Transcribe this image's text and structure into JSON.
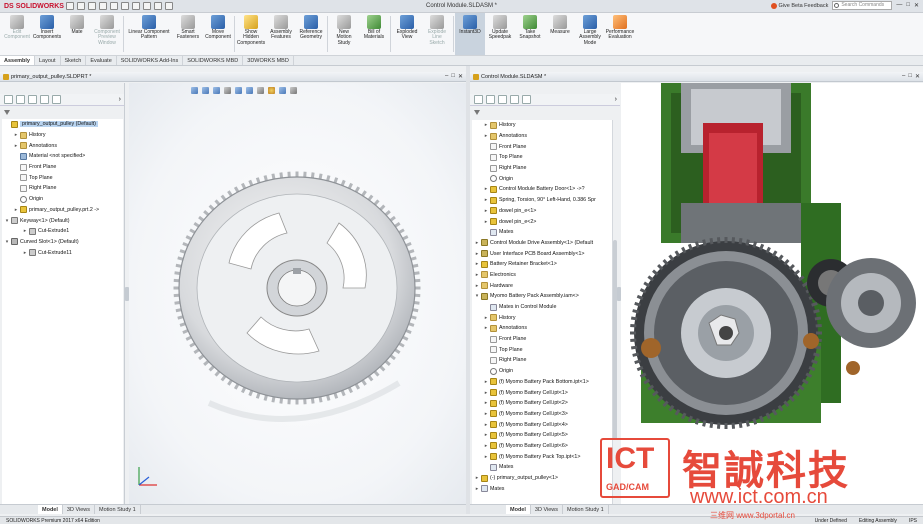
{
  "app": {
    "logo_ds": "DS",
    "logo_sw": "SOLIDWORKS",
    "doc_title": "Control Module.SLDASM *",
    "beta": "Give Beta Feedback",
    "search_placeholder": "Search Commands",
    "win_min": "—",
    "win_max": "□",
    "win_close": "✕"
  },
  "ribbon": [
    {
      "label": "Edit\nComponent",
      "state": "disabled",
      "icon": "edit-component-icon",
      "color": "gray"
    },
    {
      "label": "Insert\nComponents",
      "state": "normal",
      "icon": "insert-components-icon",
      "color": "blue"
    },
    {
      "label": "Mate",
      "state": "normal",
      "icon": "mate-icon",
      "color": "gray"
    },
    {
      "label": "Component\nPreview\nWindow",
      "state": "disabled",
      "icon": "preview-window-icon",
      "color": "gray"
    },
    {
      "label": "Linear Component\nPattern",
      "state": "normal",
      "icon": "linear-pattern-icon",
      "color": "blue",
      "wide": true
    },
    {
      "label": "Smart\nFasteners",
      "state": "normal",
      "icon": "smart-fasteners-icon",
      "color": "gray"
    },
    {
      "label": "Move\nComponent",
      "state": "normal",
      "icon": "move-component-icon",
      "color": "blue"
    },
    {
      "label": "Show\nHidden\nComponents",
      "state": "normal",
      "icon": "show-hidden-icon",
      "color": "yellow"
    },
    {
      "label": "Assembly\nFeatures",
      "state": "normal",
      "icon": "assembly-features-icon",
      "color": "gray"
    },
    {
      "label": "Reference\nGeometry",
      "state": "normal",
      "icon": "reference-geometry-icon",
      "color": "blue"
    },
    {
      "label": "New\nMotion\nStudy",
      "state": "normal",
      "icon": "motion-study-icon",
      "color": "gray"
    },
    {
      "label": "Bill of\nMaterials",
      "state": "normal",
      "icon": "bom-icon",
      "color": "green"
    },
    {
      "label": "Exploded\nView",
      "state": "normal",
      "icon": "exploded-view-icon",
      "color": "blue"
    },
    {
      "label": "Explode\nLine\nSketch",
      "state": "disabled",
      "icon": "explode-line-icon",
      "color": "gray"
    },
    {
      "label": "Instant3D",
      "state": "active",
      "icon": "instant3d-icon",
      "color": "blue"
    },
    {
      "label": "Update\nSpeedpak",
      "state": "normal",
      "icon": "speedpak-icon",
      "color": "gray"
    },
    {
      "label": "Take\nSnapshot",
      "state": "normal",
      "icon": "snapshot-icon",
      "color": "green"
    },
    {
      "label": "Measure",
      "state": "normal",
      "icon": "measure-icon",
      "color": "gray"
    },
    {
      "label": "Large\nAssembly\nMode",
      "state": "normal",
      "icon": "large-assembly-icon",
      "color": "blue"
    },
    {
      "label": "Performance\nEvaluation",
      "state": "normal",
      "icon": "performance-icon",
      "color": "orange"
    }
  ],
  "tabs": [
    {
      "label": "Assembly",
      "active": true
    },
    {
      "label": "Layout"
    },
    {
      "label": "Sketch"
    },
    {
      "label": "Evaluate"
    },
    {
      "label": "SOLIDWORKS Add-Ins"
    },
    {
      "label": "SOLIDWORKS MBD"
    },
    {
      "label": "3DWORKS MBD"
    }
  ],
  "left": {
    "title": "primary_output_pulley.SLDPRT *",
    "tree": [
      {
        "i": 0,
        "ex": "",
        "icon": "part",
        "label": "primary_output_pulley  (Default)",
        "sel": true
      },
      {
        "i": 1,
        "ex": "▸",
        "icon": "folder",
        "label": "History"
      },
      {
        "i": 1,
        "ex": "▸",
        "icon": "folder",
        "label": "Annotations"
      },
      {
        "i": 1,
        "ex": "",
        "icon": "mat",
        "label": "Material <not specified>"
      },
      {
        "i": 1,
        "ex": "",
        "icon": "plane",
        "label": "Front Plane"
      },
      {
        "i": 1,
        "ex": "",
        "icon": "plane",
        "label": "Top Plane"
      },
      {
        "i": 1,
        "ex": "",
        "icon": "plane",
        "label": "Right Plane"
      },
      {
        "i": 1,
        "ex": "",
        "icon": "origin",
        "label": "Origin"
      },
      {
        "i": 1,
        "ex": "▸",
        "icon": "part",
        "label": "primary_output_pulley.prt.2 ->"
      },
      {
        "i": 0,
        "ex": "▾",
        "icon": "feat",
        "label": "Keyway<1> (Default)"
      },
      {
        "i": 2,
        "ex": "▸",
        "icon": "feat",
        "label": "Cut-Extrude1"
      },
      {
        "i": 0,
        "ex": "▾",
        "icon": "slot",
        "label": "Curved Slot<1> (Default)"
      },
      {
        "i": 2,
        "ex": "▸",
        "icon": "feat",
        "label": "Cut-Extrude11"
      }
    ],
    "tabs": [
      {
        "label": "Model",
        "active": true
      },
      {
        "label": "3D Views"
      },
      {
        "label": "Motion Study 1"
      }
    ]
  },
  "right": {
    "title": "Control Module.SLDASM *",
    "tree": [
      {
        "i": 1,
        "ex": "▸",
        "icon": "folder",
        "label": "History"
      },
      {
        "i": 1,
        "ex": "▸",
        "icon": "folder",
        "label": "Annotations"
      },
      {
        "i": 1,
        "ex": "",
        "icon": "plane",
        "label": "Front Plane"
      },
      {
        "i": 1,
        "ex": "",
        "icon": "plane",
        "label": "Top Plane"
      },
      {
        "i": 1,
        "ex": "",
        "icon": "plane",
        "label": "Right Plane"
      },
      {
        "i": 1,
        "ex": "",
        "icon": "origin",
        "label": "Origin"
      },
      {
        "i": 1,
        "ex": "▸",
        "icon": "part",
        "label": "Control Module Battery Door<1> ->?"
      },
      {
        "i": 1,
        "ex": "▸",
        "icon": "part",
        "label": "Spring, Torsion, 90° Left-Hand, 0.386 Spr"
      },
      {
        "i": 1,
        "ex": "▸",
        "icon": "part",
        "label": "dowel pin_e<1>"
      },
      {
        "i": 1,
        "ex": "▸",
        "icon": "part",
        "label": "dowel pin_e<2>"
      },
      {
        "i": 1,
        "ex": "",
        "icon": "mates",
        "label": "Mates"
      },
      {
        "i": 0,
        "ex": "▸",
        "icon": "asm",
        "label": "Control Module Drive Assembly<1> (Default"
      },
      {
        "i": 0,
        "ex": "▸",
        "icon": "asm",
        "label": "User Interface PCB Board Assembly<1>"
      },
      {
        "i": 0,
        "ex": "▸",
        "icon": "part",
        "label": "Battery Retainer Bracket<1>"
      },
      {
        "i": 0,
        "ex": "▸",
        "icon": "folder",
        "label": "Electronics"
      },
      {
        "i": 0,
        "ex": "▸",
        "icon": "folder",
        "label": "Hardware"
      },
      {
        "i": 0,
        "ex": "▾",
        "icon": "asm",
        "label": "Myomo Battery Pack Assembly.iam<>"
      },
      {
        "i": 1,
        "ex": "",
        "icon": "mates",
        "label": "Mates in Control Module"
      },
      {
        "i": 1,
        "ex": "▸",
        "icon": "folder",
        "label": "History"
      },
      {
        "i": 1,
        "ex": "▸",
        "icon": "folder",
        "label": "Annotations"
      },
      {
        "i": 1,
        "ex": "",
        "icon": "plane",
        "label": "Front Plane"
      },
      {
        "i": 1,
        "ex": "",
        "icon": "plane",
        "label": "Top Plane"
      },
      {
        "i": 1,
        "ex": "",
        "icon": "plane",
        "label": "Right Plane"
      },
      {
        "i": 1,
        "ex": "",
        "icon": "origin",
        "label": "Origin"
      },
      {
        "i": 1,
        "ex": "▸",
        "icon": "part",
        "label": "(f) Myomo Battery Pack Bottom.ipt<1>"
      },
      {
        "i": 1,
        "ex": "▸",
        "icon": "part",
        "label": "(f) Myomo Battery Cell.ipt<1>"
      },
      {
        "i": 1,
        "ex": "▸",
        "icon": "part",
        "label": "(f) Myomo Battery Cell.ipt<2>"
      },
      {
        "i": 1,
        "ex": "▸",
        "icon": "part",
        "label": "(f) Myomo Battery Cell.ipt<3>"
      },
      {
        "i": 1,
        "ex": "▸",
        "icon": "part",
        "label": "(f) Myomo Battery Cell.ipt<4>"
      },
      {
        "i": 1,
        "ex": "▸",
        "icon": "part",
        "label": "(f) Myomo Battery Cell.ipt<5>"
      },
      {
        "i": 1,
        "ex": "▸",
        "icon": "part",
        "label": "(f) Myomo Battery Cell.ipt<6>"
      },
      {
        "i": 1,
        "ex": "▸",
        "icon": "part",
        "label": "(f) Myomo Battery Pack Top.ipt<1>"
      },
      {
        "i": 1,
        "ex": "",
        "icon": "mates",
        "label": "Mates"
      },
      {
        "i": 0,
        "ex": "▸",
        "icon": "part",
        "label": "(-) primary_output_pulley<1>"
      },
      {
        "i": 0,
        "ex": "▸",
        "icon": "mates",
        "label": "Mates"
      }
    ],
    "tabs": [
      {
        "label": "Model",
        "active": true
      },
      {
        "label": "3D Views"
      },
      {
        "label": "Motion Study 1"
      }
    ]
  },
  "status": {
    "left": "SOLIDWORKS Premium 2017 x64 Edition",
    "mid1": "Under Defined",
    "mid2": "Editing Assembly",
    "units": "IPS"
  },
  "watermark": {
    "ict": "ICT",
    "gadcam": "GAD/CAM",
    "cn": "智誠科技",
    "url": "www.ict.com.cn",
    "site": "三维网 www.3dportal.cn"
  }
}
